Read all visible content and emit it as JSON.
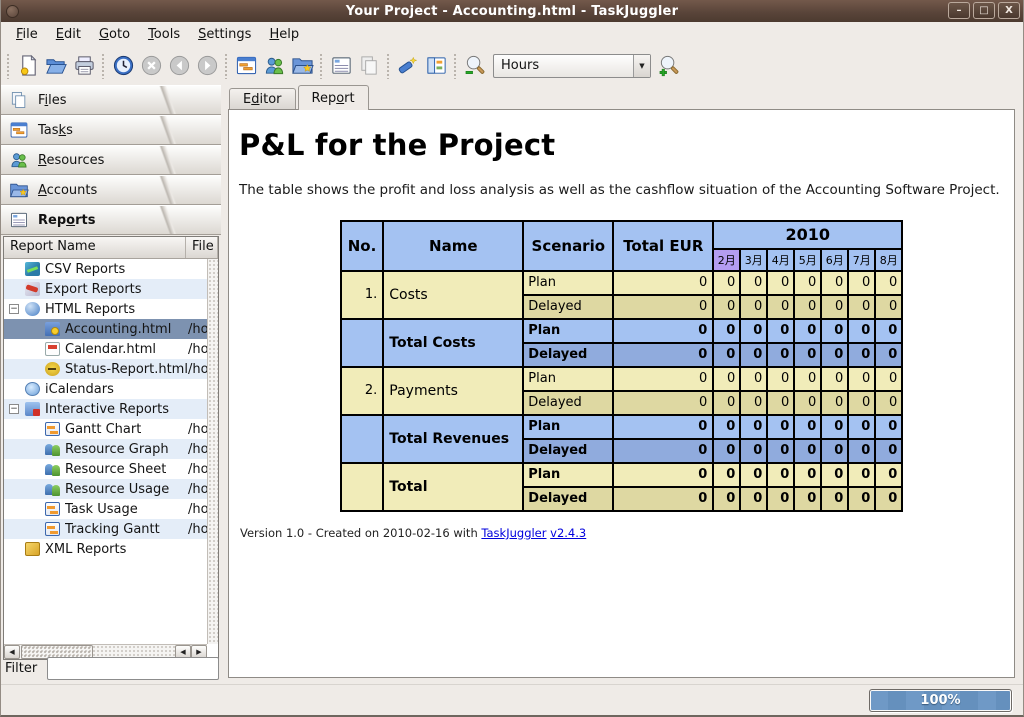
{
  "window": {
    "title": "Your Project - Accounting.html - TaskJuggler",
    "controls": {
      "minimize": "–",
      "maximize": "□",
      "close": "X"
    }
  },
  "menu": {
    "items": [
      {
        "pre": "",
        "u": "F",
        "post": "ile"
      },
      {
        "pre": "",
        "u": "E",
        "post": "dit"
      },
      {
        "pre": "",
        "u": "G",
        "post": "oto"
      },
      {
        "pre": "",
        "u": "T",
        "post": "ools"
      },
      {
        "pre": "",
        "u": "S",
        "post": "ettings"
      },
      {
        "pre": "",
        "u": "H",
        "post": "elp"
      }
    ]
  },
  "toolbar": {
    "icons": [
      "new-file-icon",
      "open-file-icon",
      "print-icon",
      "schedule-clock-icon",
      "stop-icon",
      "back-icon",
      "forward-icon",
      "tasks-gantt-icon",
      "resources-icon",
      "accounts-icon",
      "reports-list-icon",
      "copy-icon",
      "check-syntax-icon",
      "side-panel-icon",
      "zoom-out-icon",
      "zoom-in-icon"
    ],
    "period_select": {
      "value": "Hours"
    }
  },
  "sidebar": {
    "sections": [
      {
        "pre": "F",
        "u": "i",
        "post": "les",
        "icon": "files-icon"
      },
      {
        "pre": "Tas",
        "u": "k",
        "post": "s",
        "icon": "tasks-icon"
      },
      {
        "pre": "",
        "u": "R",
        "post": "esources",
        "icon": "resources-icon"
      },
      {
        "pre": "",
        "u": "A",
        "post": "ccounts",
        "icon": "accounts-icon"
      },
      {
        "pre": "Rep",
        "u": "o",
        "post": "rts",
        "icon": "reports-icon",
        "active": true
      }
    ],
    "tree": {
      "columns": [
        "Report Name",
        "File"
      ],
      "items": [
        {
          "label": "CSV Reports",
          "level": 1,
          "icon": "csv"
        },
        {
          "label": "Export Reports",
          "level": 1,
          "icon": "export"
        },
        {
          "label": "HTML Reports",
          "level": 1,
          "icon": "web",
          "expander": true
        },
        {
          "label": "Accounting.html",
          "level": 2,
          "icon": "folder-star",
          "file": "/hor",
          "selected": true
        },
        {
          "label": "Calendar.html",
          "level": 2,
          "icon": "calendar",
          "file": "/hor"
        },
        {
          "label": "Status-Report.html",
          "level": 2,
          "icon": "bee",
          "file": "/hor"
        },
        {
          "label": "iCalendars",
          "level": 1,
          "icon": "ical"
        },
        {
          "label": "Interactive Reports",
          "level": 1,
          "icon": "interactive",
          "expander": true
        },
        {
          "label": "Gantt Chart",
          "level": 2,
          "icon": "gantt",
          "file": "/hor"
        },
        {
          "label": "Resource Graph",
          "level": 2,
          "icon": "people",
          "file": "/hor"
        },
        {
          "label": "Resource Sheet",
          "level": 2,
          "icon": "people",
          "file": "/hor"
        },
        {
          "label": "Resource Usage",
          "level": 2,
          "icon": "people",
          "file": "/hor"
        },
        {
          "label": "Task Usage",
          "level": 2,
          "icon": "gantt",
          "file": "/hor"
        },
        {
          "label": "Tracking Gantt",
          "level": 2,
          "icon": "gantt",
          "file": "/hor"
        },
        {
          "label": "XML Reports",
          "level": 1,
          "icon": "xml"
        }
      ]
    },
    "filter_label": "Filter",
    "filter_value": ""
  },
  "tabs": [
    {
      "pre": "E",
      "u": "d",
      "post": "itor"
    },
    {
      "pre": "Rep",
      "u": "o",
      "post": "rt",
      "active": true
    }
  ],
  "report": {
    "title": "P&L for the Project",
    "description": "The table shows the profit and loss analysis as well as the cashflow situation of the Accounting Software Project.",
    "footer": {
      "prefix": "Version 1.0 - Created on 2010-02-16 with ",
      "link1": "TaskJuggler",
      "link2": "v2.4.3"
    }
  },
  "chart_data": {
    "type": "table",
    "title": "P&L for the Project",
    "headers": {
      "no": "No.",
      "name": "Name",
      "scenario": "Scenario",
      "total": "Total EUR",
      "year": "2010",
      "months": [
        "2月",
        "3月",
        "4月",
        "5月",
        "6月",
        "7月",
        "8月"
      ],
      "current_month_index": 0
    },
    "groups": [
      {
        "no": "1.",
        "name": "Costs",
        "style": "yellow",
        "bold": false,
        "rows": [
          {
            "scenario": "Plan",
            "total": "0",
            "months": [
              "0",
              "0",
              "0",
              "0",
              "0",
              "0",
              "0"
            ]
          },
          {
            "scenario": "Delayed",
            "total": "0",
            "months": [
              "0",
              "0",
              "0",
              "0",
              "0",
              "0",
              "0"
            ]
          }
        ]
      },
      {
        "no": "",
        "name": "Total Costs",
        "style": "blue",
        "bold": true,
        "rows": [
          {
            "scenario": "Plan",
            "total": "0",
            "months": [
              "0",
              "0",
              "0",
              "0",
              "0",
              "0",
              "0"
            ]
          },
          {
            "scenario": "Delayed",
            "total": "0",
            "months": [
              "0",
              "0",
              "0",
              "0",
              "0",
              "0",
              "0"
            ]
          }
        ]
      },
      {
        "no": "2.",
        "name": "Payments",
        "style": "yellow",
        "bold": false,
        "rows": [
          {
            "scenario": "Plan",
            "total": "0",
            "months": [
              "0",
              "0",
              "0",
              "0",
              "0",
              "0",
              "0"
            ]
          },
          {
            "scenario": "Delayed",
            "total": "0",
            "months": [
              "0",
              "0",
              "0",
              "0",
              "0",
              "0",
              "0"
            ]
          }
        ]
      },
      {
        "no": "",
        "name": "Total Revenues",
        "style": "blue",
        "bold": true,
        "rows": [
          {
            "scenario": "Plan",
            "total": "0",
            "months": [
              "0",
              "0",
              "0",
              "0",
              "0",
              "0",
              "0"
            ]
          },
          {
            "scenario": "Delayed",
            "total": "0",
            "months": [
              "0",
              "0",
              "0",
              "0",
              "0",
              "0",
              "0"
            ]
          }
        ]
      },
      {
        "no": "",
        "name": "Total",
        "style": "yellow",
        "bold": true,
        "rows": [
          {
            "scenario": "Plan",
            "total": "0",
            "months": [
              "0",
              "0",
              "0",
              "0",
              "0",
              "0",
              "0"
            ]
          },
          {
            "scenario": "Delayed",
            "total": "0",
            "months": [
              "0",
              "0",
              "0",
              "0",
              "0",
              "0",
              "0"
            ]
          }
        ]
      }
    ]
  },
  "statusbar": {
    "progress": "100%"
  },
  "colors": {
    "titlebar": "#5a453a",
    "header_blue": "#a4c2f2",
    "row_blue_dark": "#90abdd",
    "row_yellow": "#f1ecb9",
    "row_yellow_dark": "#ded8a2",
    "current_month": "#b49df1",
    "tree_selection": "#7d92b0",
    "progress_blue": "#6f99c6",
    "link": "#0000dd"
  }
}
